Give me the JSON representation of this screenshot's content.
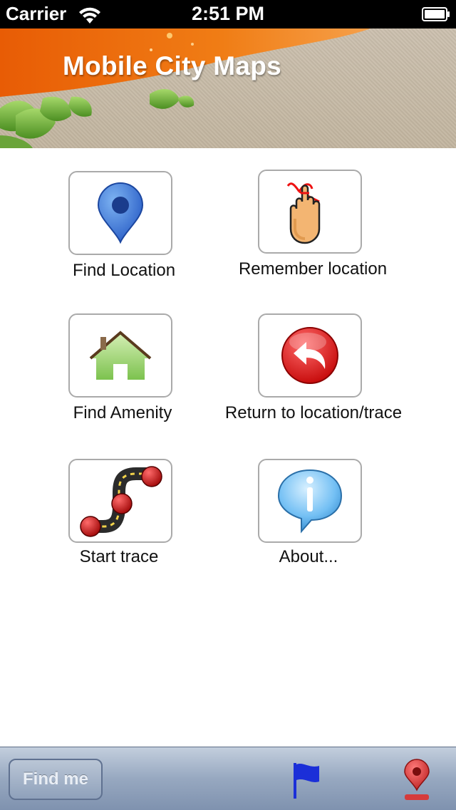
{
  "status_bar": {
    "carrier": "Carrier",
    "time": "2:51 PM",
    "wifi_icon": "wifi-icon",
    "battery_icon": "battery-icon"
  },
  "header": {
    "title": "Mobile City Maps",
    "accent_color": "#ef6d0e"
  },
  "menu": {
    "items": [
      {
        "label": "Find Location",
        "icon": "map-pin-icon"
      },
      {
        "label": "Remember location",
        "icon": "finger-string-icon"
      },
      {
        "label": "Find Amenity",
        "icon": "house-icon"
      },
      {
        "label": "Return to location/trace",
        "icon": "return-arrow-icon"
      },
      {
        "label": "Start trace",
        "icon": "trace-path-icon"
      },
      {
        "label": "About...",
        "icon": "info-bubble-icon"
      }
    ]
  },
  "toolbar": {
    "find_me_label": "Find me",
    "flag_icon": "flag-icon",
    "pin_icon": "location-pin-icon"
  }
}
